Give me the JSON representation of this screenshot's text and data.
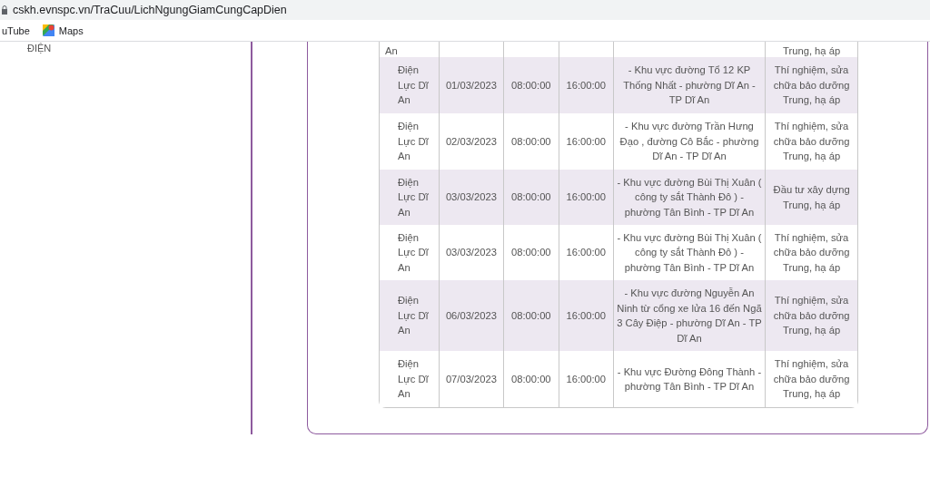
{
  "address_bar": {
    "url": "cskh.evnspc.vn/TraCuu/LichNgungGiamCungCapDien"
  },
  "bookmarks": [
    {
      "label": "uTube",
      "kind": "plain"
    },
    {
      "label": "Maps",
      "kind": "maps"
    }
  ],
  "sidebar": {
    "items": [
      "ĐIỆN"
    ]
  },
  "table": {
    "partial_row": {
      "column_1": "An",
      "column_6": "Trung, hạ áp"
    },
    "rows": [
      {
        "unit": "Điện Lực Dĩ An",
        "date": "01/03/2023",
        "start": "08:00:00",
        "end": "16:00:00",
        "area": "- Khu vực đường Tổ 12 KP Thống Nhất - phường Dĩ An - TP Dĩ An",
        "reason": "Thí nghiệm, sửa chữa bảo dưỡng Trung, hạ áp"
      },
      {
        "unit": "Điện Lực Dĩ An",
        "date": "02/03/2023",
        "start": "08:00:00",
        "end": "16:00:00",
        "area": "- Khu vực đường Trần Hưng Đạo , đường Cô Bắc - phường Dĩ An - TP Dĩ An",
        "reason": "Thí nghiệm, sửa chữa bảo dưỡng Trung, hạ áp"
      },
      {
        "unit": "Điện Lực Dĩ An",
        "date": "03/03/2023",
        "start": "08:00:00",
        "end": "16:00:00",
        "area": "- Khu vực đường Bùi Thị Xuân ( công ty sắt Thành Đô ) - phường Tân Bình - TP Dĩ An",
        "reason": "Đầu tư xây dựng Trung, hạ áp"
      },
      {
        "unit": "Điện Lực Dĩ An",
        "date": "03/03/2023",
        "start": "08:00:00",
        "end": "16:00:00",
        "area": "- Khu vực đường Bùi Thị Xuân ( công ty sắt Thành Đô ) - phường Tân Bình - TP Dĩ An",
        "reason": "Thí nghiệm, sửa chữa bảo dưỡng Trung, hạ áp"
      },
      {
        "unit": "Điện Lực Dĩ An",
        "date": "06/03/2023",
        "start": "08:00:00",
        "end": "16:00:00",
        "area": "- Khu vực đường Nguyễn An Ninh từ cổng xe lửa 16 đến Ngã 3 Cây Điệp - phường Dĩ An - TP Dĩ An",
        "reason": "Thí nghiệm, sửa chữa bảo dưỡng Trung, hạ áp"
      },
      {
        "unit": "Điện Lực Dĩ An",
        "date": "07/03/2023",
        "start": "08:00:00",
        "end": "16:00:00",
        "area": "- Khu vực Đường Đông Thành - phường Tân Bình - TP Dĩ An",
        "reason": "Thí nghiệm, sửa chữa bảo dưỡng Trung, hạ áp"
      }
    ]
  }
}
